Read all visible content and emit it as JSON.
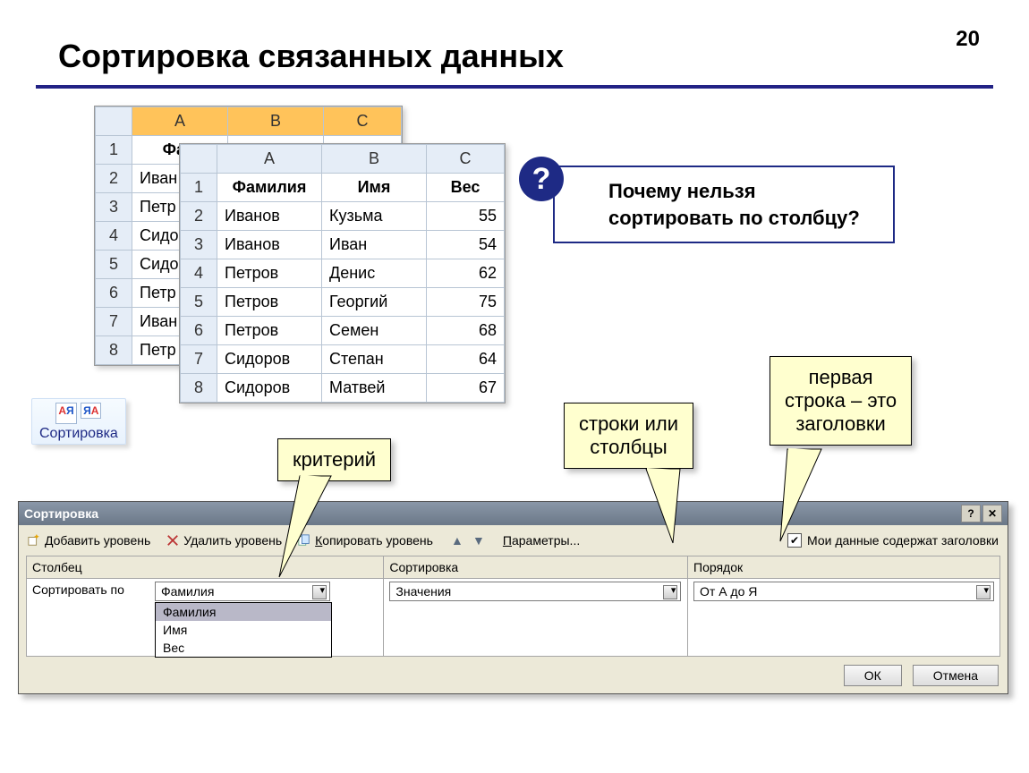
{
  "page_no": "20",
  "title": "Сортировка связанных данных",
  "question": "Почему нельзя сортировать по столбцу?",
  "ribbon": {
    "sort_label": "Сортировка"
  },
  "callouts": {
    "criterion": "критерий",
    "rows_or_cols_l1": "строки или",
    "rows_or_cols_l2": "столбцы",
    "first_row_l1": "первая",
    "first_row_l2": "строка – это",
    "first_row_l3": "заголовки"
  },
  "sheet_back": {
    "cols": [
      "A",
      "B",
      "C"
    ],
    "rows": [
      {
        "n": "1",
        "a": "Фам"
      },
      {
        "n": "2",
        "a": "Иван"
      },
      {
        "n": "3",
        "a": "Петр"
      },
      {
        "n": "4",
        "a": "Сидо"
      },
      {
        "n": "5",
        "a": "Сидо"
      },
      {
        "n": "6",
        "a": "Петр"
      },
      {
        "n": "7",
        "a": "Иван"
      },
      {
        "n": "8",
        "a": "Петр"
      }
    ]
  },
  "sheet_front": {
    "cols": [
      "A",
      "B",
      "C"
    ],
    "headers": [
      "Фамилия",
      "Имя",
      "Вес"
    ],
    "rows": [
      {
        "a": "Иванов",
        "b": "Кузьма",
        "c": 55
      },
      {
        "a": "Иванов",
        "b": "Иван",
        "c": 54
      },
      {
        "a": "Петров",
        "b": "Денис",
        "c": 62
      },
      {
        "a": "Петров",
        "b": "Георгий",
        "c": 75
      },
      {
        "a": "Петров",
        "b": "Семен",
        "c": 68
      },
      {
        "a": "Сидоров",
        "b": "Степан",
        "c": 64
      },
      {
        "a": "Сидоров",
        "b": "Матвей",
        "c": 67
      }
    ]
  },
  "dialog": {
    "title": "Сортировка",
    "add_u": "Д",
    "add_rest": "обавить уровень",
    "delete_label": "Удалить уровень",
    "copy_u": "К",
    "copy_rest": "опировать уровень",
    "options_u": "П",
    "options_rest": "араметры...",
    "headers_chk": "Мои данные содержат заголовки",
    "cols": {
      "column": "Столбец",
      "sort_on": "Сортировка",
      "order": "Порядок"
    },
    "sort_by": "Сортировать по",
    "dd_col_sel": "Фамилия",
    "dd_col_opts": [
      "Фамилия",
      "Имя",
      "Вес"
    ],
    "dd_sorton": "Значения",
    "dd_order": "От А до Я",
    "ok": "ОК",
    "cancel": "Отмена"
  }
}
